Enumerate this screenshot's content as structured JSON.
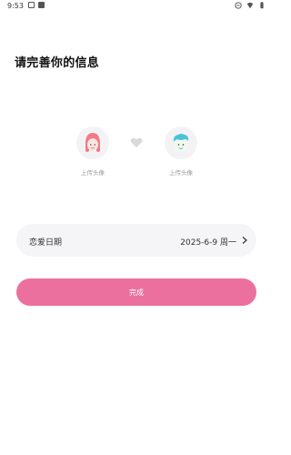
{
  "status_bar": {
    "time": "9:53",
    "left_icons": [
      "image-icon",
      "a-icon"
    ],
    "right_icons": [
      "dnd-icon",
      "wifi-icon",
      "battery-icon"
    ]
  },
  "page": {
    "title": "请完善你的信息"
  },
  "avatars": {
    "female_label": "上传头像",
    "male_label": "上传头像"
  },
  "date": {
    "label": "恋爱日期",
    "value": "2025-6-9 周一"
  },
  "actions": {
    "done_label": "完成"
  },
  "colors": {
    "accent": "#ec709d",
    "female_hair": "#f07b86",
    "male_hair": "#49c4d6",
    "row_bg": "#f5f5f7"
  }
}
